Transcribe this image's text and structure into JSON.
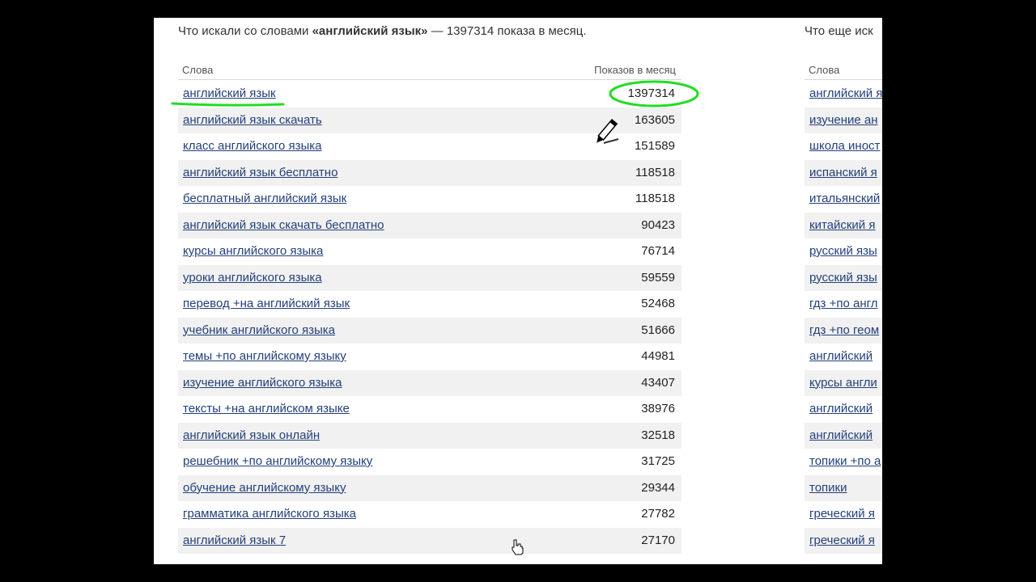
{
  "left": {
    "heading_prefix": "Что искали со словами ",
    "heading_query": "«английский язык»",
    "heading_suffix": " — 1397314 показа в месяц.",
    "col_words": "Слова",
    "col_shows": "Показов в месяц",
    "rows": [
      {
        "term": "английский язык",
        "count": "1397314"
      },
      {
        "term": "английский язык скачать",
        "count": "163605"
      },
      {
        "term": "класс английского языка",
        "count": "151589"
      },
      {
        "term": "английский язык бесплатно",
        "count": "118518"
      },
      {
        "term": "бесплатный английский язык",
        "count": "118518"
      },
      {
        "term": "английский язык скачать бесплатно",
        "count": "90423"
      },
      {
        "term": "курсы английского языка",
        "count": "76714"
      },
      {
        "term": "уроки английского языка",
        "count": "59559"
      },
      {
        "term": "перевод +на английский язык",
        "count": "52468"
      },
      {
        "term": "учебник английского языка",
        "count": "51666"
      },
      {
        "term": "темы +по английскому языку",
        "count": "44981"
      },
      {
        "term": "изучение английского языка",
        "count": "43407"
      },
      {
        "term": "тексты +на английском языке",
        "count": "38976"
      },
      {
        "term": "английский язык онлайн",
        "count": "32518"
      },
      {
        "term": "решебник +по английскому языку",
        "count": "31725"
      },
      {
        "term": "обучение английскому языку",
        "count": "29344"
      },
      {
        "term": "грамматика английского языка",
        "count": "27782"
      },
      {
        "term": "английский язык 7",
        "count": "27170"
      }
    ]
  },
  "right": {
    "heading": "Что еще иск",
    "col_words": "Слова",
    "rows": [
      {
        "term": "английский я"
      },
      {
        "term": "изучение ан"
      },
      {
        "term": "школа иност"
      },
      {
        "term": "испанский я"
      },
      {
        "term": "итальянский"
      },
      {
        "term": "китайский я"
      },
      {
        "term": "русский язы"
      },
      {
        "term": "русский язы"
      },
      {
        "term": "гдз +по англ"
      },
      {
        "term": "гдз +по геом"
      },
      {
        "term": "английский"
      },
      {
        "term": "курсы англи"
      },
      {
        "term": "английский"
      },
      {
        "term": "английский"
      },
      {
        "term": "топики +по а"
      },
      {
        "term": "топики"
      },
      {
        "term": "греческий я"
      },
      {
        "term": "греческий я"
      }
    ]
  },
  "colors": {
    "link": "#23407a",
    "row_alt": "#f1f1f1",
    "highlight": "#22dd22"
  }
}
